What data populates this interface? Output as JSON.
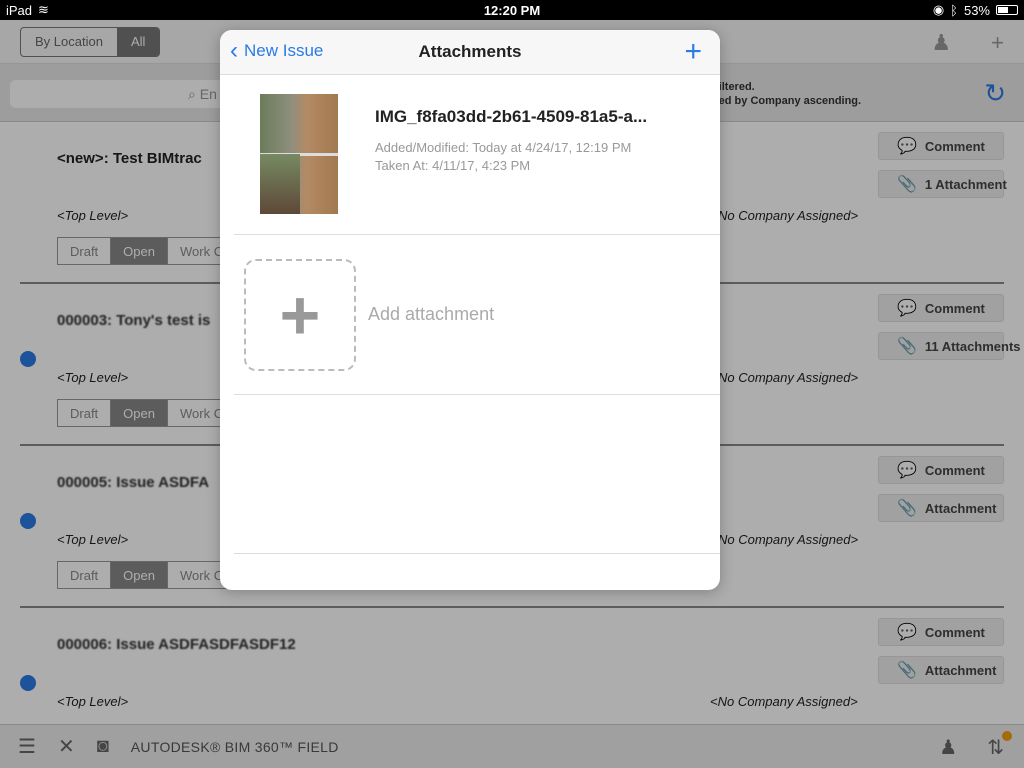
{
  "statusbar": {
    "device": "iPad",
    "time": "12:20 PM",
    "battery": "53%"
  },
  "topbar": {
    "seg_location": "By Location",
    "seg_all": "All"
  },
  "search": {
    "placeholder_fragment": "En",
    "filter_line1": "filtered.",
    "filter_line2": "ted by Company ascending."
  },
  "issues": [
    {
      "title": "<new>: Test BIMtrac",
      "location": "<Top Level>",
      "company": "No Company Assigned>",
      "statuses": [
        "Draft",
        "Open",
        "Work Co"
      ],
      "comment": "Comment",
      "attachment": "1 Attachment"
    },
    {
      "title": "000003: Tony's test is",
      "location": "<Top Level>",
      "company": "No Company Assigned>",
      "statuses": [
        "Draft",
        "Open",
        "Work Co"
      ],
      "comment": "Comment",
      "attachment": "11 Attachments"
    },
    {
      "title": "000005: Issue ASDFA",
      "location": "<Top Level>",
      "company": "No Company Assigned>",
      "statuses": [
        "Draft",
        "Open",
        "Work Co"
      ],
      "comment": "Comment",
      "attachment": "Attachment"
    },
    {
      "title": "000006: Issue ASDFASDFASDF12",
      "location": "<Top Level>",
      "company": "<No Company Assigned>",
      "statuses": [
        "",
        "",
        ""
      ],
      "comment": "Comment",
      "attachment": "Attachment"
    }
  ],
  "bottombar": {
    "brand": "AUTODESK® BIM 360™ FIELD"
  },
  "popover": {
    "back_label": "New Issue",
    "title": "Attachments",
    "attachment": {
      "filename": "IMG_f8fa03dd-2b61-4509-81a5-a...",
      "added": "Added/Modified: Today at 4/24/17, 12:19 PM",
      "taken": "Taken At: 4/11/17, 4:23 PM"
    },
    "add_label": "Add attachment"
  },
  "colors": {
    "accent": "#2a7be4",
    "notification": "#f39c12"
  }
}
